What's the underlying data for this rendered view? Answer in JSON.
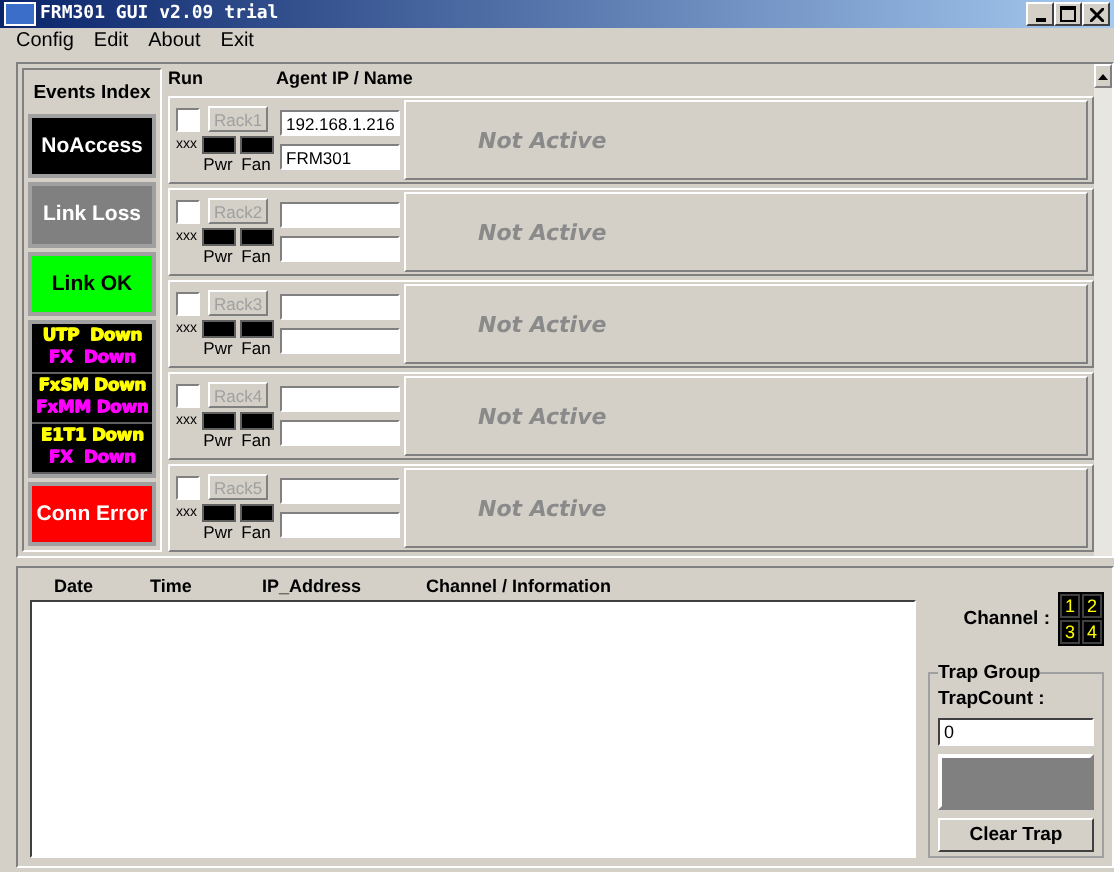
{
  "window": {
    "title": "FRM301  GUI  v2.09  trial"
  },
  "menu": [
    {
      "label": "Config"
    },
    {
      "label": "Edit"
    },
    {
      "label": "About"
    },
    {
      "label": "Exit"
    }
  ],
  "events_index": {
    "title": "Events Index",
    "items": [
      {
        "kind": "block",
        "label": "NoAccess",
        "color": "#000000"
      },
      {
        "kind": "block",
        "label": "Link Loss",
        "color": "#808080"
      },
      {
        "kind": "block",
        "label": "Link OK",
        "color": "#00ff00"
      },
      {
        "kind": "alarms",
        "groups": [
          [
            {
              "label": "UTP  Down",
              "color": "#ffff00"
            },
            {
              "label": "FX  Down",
              "color": "#ff00ff"
            }
          ],
          [
            {
              "label": "FxSM Down",
              "color": "#ffff00"
            },
            {
              "label": "FxMM Down",
              "color": "#ff00ff"
            }
          ],
          [
            {
              "label": "E1T1 Down",
              "color": "#ffff00"
            },
            {
              "label": "FX  Down",
              "color": "#ff00ff"
            }
          ]
        ]
      },
      {
        "kind": "block",
        "label": "Conn Error",
        "color": "#ff0000"
      }
    ]
  },
  "racks_header": {
    "run": "Run",
    "agent": "Agent IP / Name"
  },
  "racks": [
    {
      "checked": false,
      "button": "Rack1",
      "disabled": true,
      "ip": "192.168.1.216",
      "name": "FRM301",
      "code": "xxx",
      "pwr": "Pwr",
      "fan": "Fan",
      "status": "Not Active"
    },
    {
      "checked": false,
      "button": "Rack2",
      "disabled": true,
      "code": "xxx",
      "pwr": "Pwr",
      "fan": "Fan",
      "status": "Not Active"
    },
    {
      "checked": false,
      "button": "Rack3",
      "disabled": true,
      "code": "xxx",
      "pwr": "Pwr",
      "fan": "Fan",
      "status": "Not Active"
    },
    {
      "checked": false,
      "button": "Rack4",
      "disabled": true,
      "code": "xxx",
      "pwr": "Pwr",
      "fan": "Fan",
      "status": "Not Active"
    },
    {
      "checked": false,
      "button": "Rack5",
      "disabled": true,
      "code": "xxx",
      "pwr": "Pwr",
      "fan": "Fan",
      "status": "Not Active"
    }
  ],
  "log": {
    "columns": [
      "Date",
      "Time",
      "IP_Address",
      "Channel  /  Information"
    ]
  },
  "channel": {
    "label": "Channel :",
    "numbers": [
      "1",
      "2",
      "3",
      "4"
    ]
  },
  "trap_group": {
    "title": "Trap Group",
    "count_label": "TrapCount :",
    "count": "0",
    "clear_button": "Clear Trap"
  }
}
